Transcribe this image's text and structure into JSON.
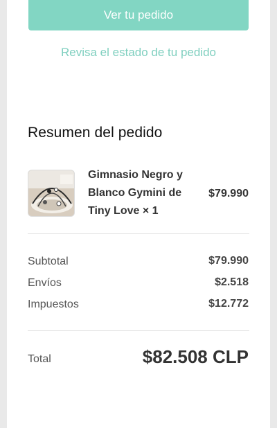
{
  "actions": {
    "view_order_label": "Ver tu pedido",
    "order_status_link": "Revisa el estado de tu pedido"
  },
  "summary": {
    "title": "Resumen del pedido",
    "product": {
      "name": "Gimnasio Negro y Blanco Gymini de Tiny Love × 1",
      "price": "$79.990",
      "thumbnail_icon": "product-photo"
    },
    "rows": [
      {
        "label": "Subtotal",
        "value": "$79.990"
      },
      {
        "label": "Envíos",
        "value": "$2.518"
      },
      {
        "label": "Impuestos",
        "value": "$12.772"
      }
    ],
    "total_label": "Total",
    "total_value": "$82.508 CLP"
  },
  "colors": {
    "accent": "#82d6c3",
    "link": "#7fcfbf",
    "background": "#e9e9e9"
  }
}
